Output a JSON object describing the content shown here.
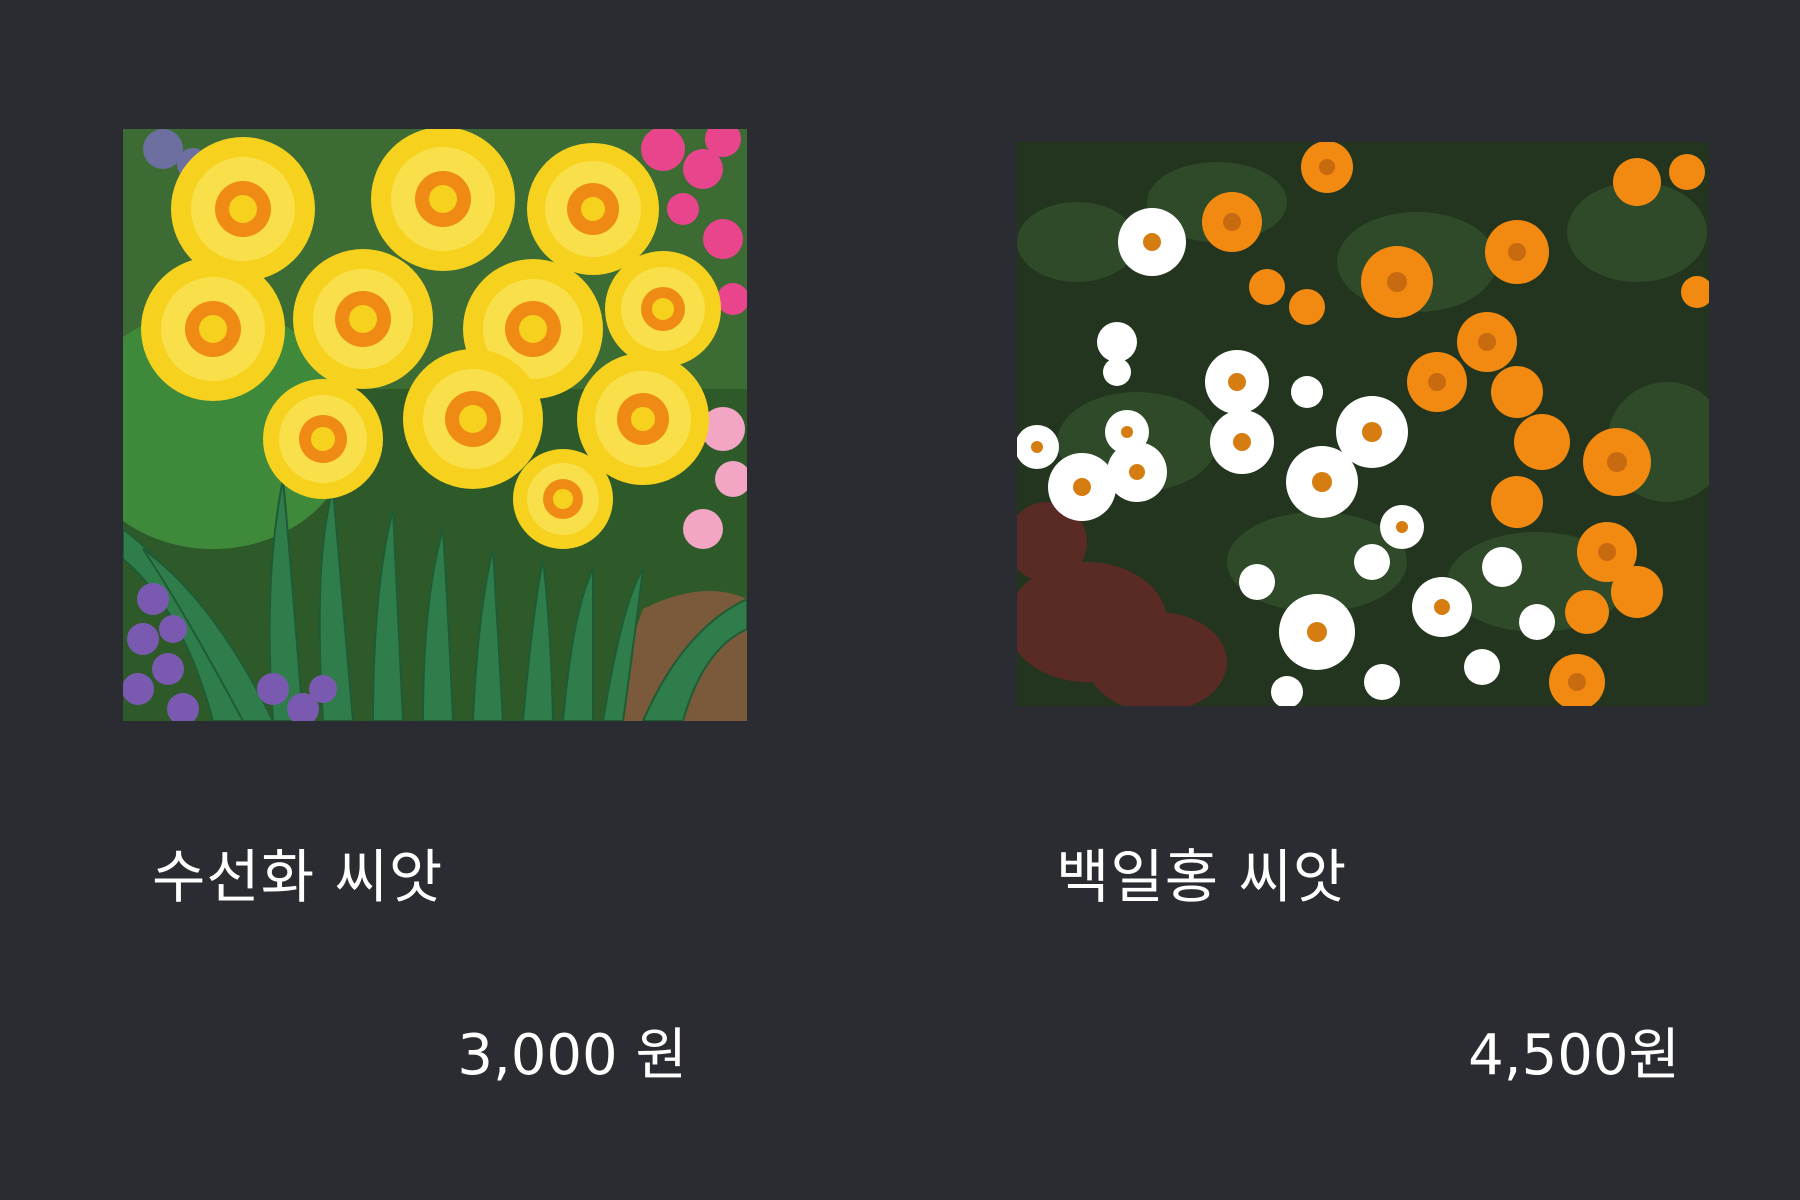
{
  "products": [
    {
      "name": "수선화 씨앗",
      "price": "3,000 원",
      "image_icon": "daffodil-photo",
      "colors": {
        "petal": "#f6d21f",
        "center": "#ef8a14",
        "leaf": "#2f7d4a",
        "bg_flower": "#e8458c",
        "hyacinth": "#7a5ab0"
      }
    },
    {
      "name": "백일홍 씨앗",
      "price": "4,500원",
      "image_icon": "zinnia-photo",
      "colors": {
        "white_petal": "#ffffff",
        "orange_petal": "#f28a12",
        "center": "#c86a10",
        "foliage": "#23351f",
        "dark": "#1c2018"
      }
    }
  ],
  "colors": {
    "background": "#2a2c31",
    "text": "#ffffff"
  }
}
